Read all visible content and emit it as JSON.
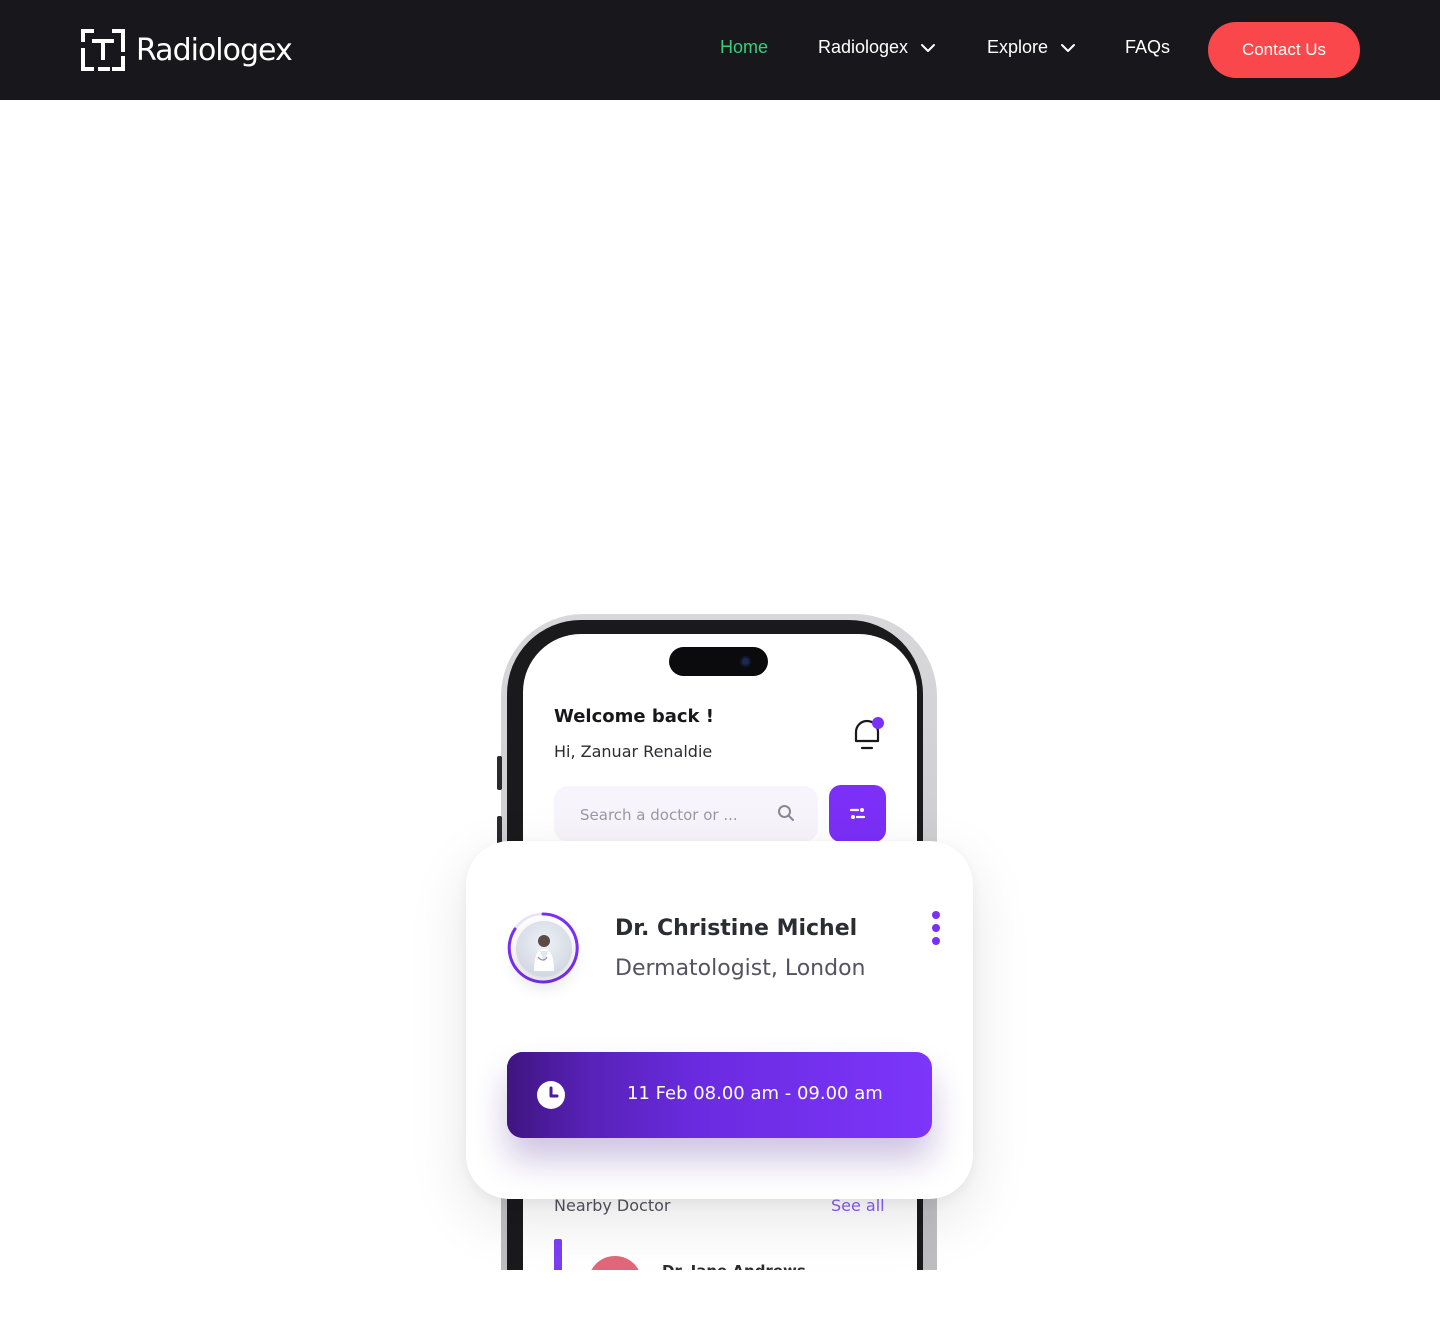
{
  "brand": {
    "name": "Radiologex"
  },
  "nav": {
    "home": "Home",
    "radiologex": "Radiologex",
    "explore": "Explore",
    "faqs": "FAQs",
    "contact": "Contact Us"
  },
  "colors": {
    "nav_bg": "#18171c",
    "active_link": "#36d07a",
    "contact_bg": "#f9474b",
    "accent": "#7b2ff7"
  },
  "app": {
    "welcome": "Welcome back !",
    "greeting": "Hi, Zanuar Renaldie",
    "search_placeholder": "Search a doctor or ...",
    "nearby_title": "Nearby Doctor",
    "see_all": "See all",
    "nearby_doctor_name": "Dr. Jane Andrews"
  },
  "doctor_card": {
    "name": "Dr. Christine Michel",
    "specialty": "Dermatologist, London",
    "appointment": "11 Feb 08.00 am - 09.00 am"
  },
  "icons": [
    "logo-icon",
    "chevron-down-icon",
    "bell-icon",
    "search-icon",
    "filter-icon",
    "more-vertical-icon",
    "clock-icon"
  ]
}
